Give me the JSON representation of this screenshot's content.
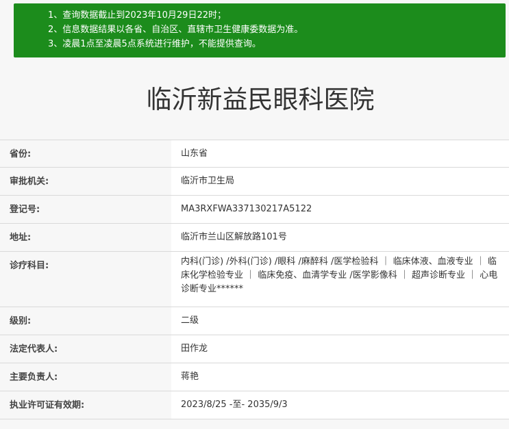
{
  "notice": {
    "lines": [
      "1、查询数据截止到2023年10月29日22时；",
      "2、信息数据结果以各省、自治区、直辖市卫生健康委数据为准。",
      "3、凌晨1点至凌晨5点系统进行维护，不能提供查询。"
    ],
    "background_color": "#1c8c1c"
  },
  "hospital": {
    "name": "临沂新益民眼科医院"
  },
  "info": {
    "rows": [
      {
        "label": "省份:",
        "value": "山东省"
      },
      {
        "label": "审批机关:",
        "value": "临沂市卫生局"
      },
      {
        "label": "登记号:",
        "value": "MA3RXFWA337130217A5122"
      },
      {
        "label": "地址:",
        "value": "临沂市兰山区解放路101号"
      },
      {
        "label": "诊疗科目:",
        "value": "内科(门诊) /外科(门诊) /眼科 /麻醉科 /医学检验科 ｜ 临床体液、血液专业 ｜ 临床化学检验专业 ｜ 临床免疫、血清学专业 /医学影像科 ｜ 超声诊断专业 ｜ 心电诊断专业******"
      },
      {
        "label": "级别:",
        "value": "二级"
      },
      {
        "label": "法定代表人:",
        "value": "田作龙"
      },
      {
        "label": "主要负责人:",
        "value": "蒋艳"
      },
      {
        "label": "执业许可证有效期:",
        "value": "2023/8/25 -至- 2035/9/3"
      }
    ]
  }
}
